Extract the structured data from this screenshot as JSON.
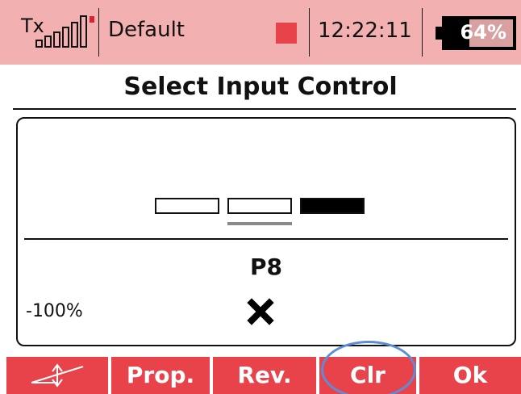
{
  "statusbar": {
    "tx_label": "Tx",
    "model_name": "Default",
    "clock": "12:22:11",
    "battery_text": "64%",
    "battery_level_pct": 64,
    "record_color": "#e8424b",
    "signal_icon": "signal-strength-icon"
  },
  "page": {
    "title": "Select Input Control"
  },
  "panel": {
    "control_name": "P8",
    "trim_value": "-100%",
    "clear_icon": "x-mark-icon",
    "selectors": [
      {
        "state": "empty"
      },
      {
        "state": "empty",
        "active": true
      },
      {
        "state": "filled"
      }
    ]
  },
  "softkeys": [
    {
      "label": "",
      "icon": "curve-icon"
    },
    {
      "label": "Prop."
    },
    {
      "label": "Rev."
    },
    {
      "label": "Clr",
      "highlighted": true
    },
    {
      "label": "Ok"
    }
  ],
  "colors": {
    "statusbar_bg": "#f3b0b0",
    "softkey_bg": "#e8424b",
    "highlight_ring": "#5b8ed6"
  }
}
